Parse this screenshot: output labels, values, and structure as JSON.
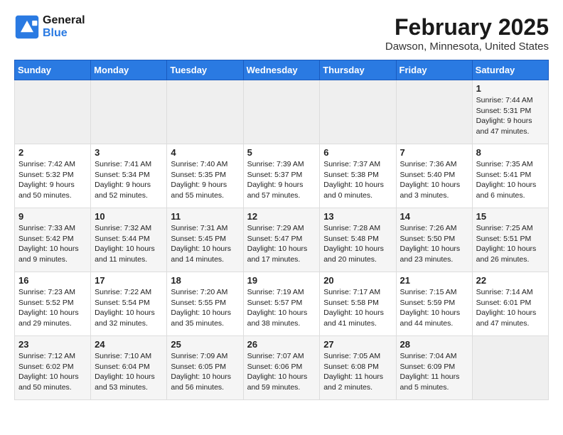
{
  "logo": {
    "line1": "General",
    "line2": "Blue"
  },
  "title": "February 2025",
  "location": "Dawson, Minnesota, United States",
  "days_of_week": [
    "Sunday",
    "Monday",
    "Tuesday",
    "Wednesday",
    "Thursday",
    "Friday",
    "Saturday"
  ],
  "weeks": [
    [
      {
        "day": "",
        "info": ""
      },
      {
        "day": "",
        "info": ""
      },
      {
        "day": "",
        "info": ""
      },
      {
        "day": "",
        "info": ""
      },
      {
        "day": "",
        "info": ""
      },
      {
        "day": "",
        "info": ""
      },
      {
        "day": "1",
        "info": "Sunrise: 7:44 AM\nSunset: 5:31 PM\nDaylight: 9 hours\nand 47 minutes."
      }
    ],
    [
      {
        "day": "2",
        "info": "Sunrise: 7:42 AM\nSunset: 5:32 PM\nDaylight: 9 hours\nand 50 minutes."
      },
      {
        "day": "3",
        "info": "Sunrise: 7:41 AM\nSunset: 5:34 PM\nDaylight: 9 hours\nand 52 minutes."
      },
      {
        "day": "4",
        "info": "Sunrise: 7:40 AM\nSunset: 5:35 PM\nDaylight: 9 hours\nand 55 minutes."
      },
      {
        "day": "5",
        "info": "Sunrise: 7:39 AM\nSunset: 5:37 PM\nDaylight: 9 hours\nand 57 minutes."
      },
      {
        "day": "6",
        "info": "Sunrise: 7:37 AM\nSunset: 5:38 PM\nDaylight: 10 hours\nand 0 minutes."
      },
      {
        "day": "7",
        "info": "Sunrise: 7:36 AM\nSunset: 5:40 PM\nDaylight: 10 hours\nand 3 minutes."
      },
      {
        "day": "8",
        "info": "Sunrise: 7:35 AM\nSunset: 5:41 PM\nDaylight: 10 hours\nand 6 minutes."
      }
    ],
    [
      {
        "day": "9",
        "info": "Sunrise: 7:33 AM\nSunset: 5:42 PM\nDaylight: 10 hours\nand 9 minutes."
      },
      {
        "day": "10",
        "info": "Sunrise: 7:32 AM\nSunset: 5:44 PM\nDaylight: 10 hours\nand 11 minutes."
      },
      {
        "day": "11",
        "info": "Sunrise: 7:31 AM\nSunset: 5:45 PM\nDaylight: 10 hours\nand 14 minutes."
      },
      {
        "day": "12",
        "info": "Sunrise: 7:29 AM\nSunset: 5:47 PM\nDaylight: 10 hours\nand 17 minutes."
      },
      {
        "day": "13",
        "info": "Sunrise: 7:28 AM\nSunset: 5:48 PM\nDaylight: 10 hours\nand 20 minutes."
      },
      {
        "day": "14",
        "info": "Sunrise: 7:26 AM\nSunset: 5:50 PM\nDaylight: 10 hours\nand 23 minutes."
      },
      {
        "day": "15",
        "info": "Sunrise: 7:25 AM\nSunset: 5:51 PM\nDaylight: 10 hours\nand 26 minutes."
      }
    ],
    [
      {
        "day": "16",
        "info": "Sunrise: 7:23 AM\nSunset: 5:52 PM\nDaylight: 10 hours\nand 29 minutes."
      },
      {
        "day": "17",
        "info": "Sunrise: 7:22 AM\nSunset: 5:54 PM\nDaylight: 10 hours\nand 32 minutes."
      },
      {
        "day": "18",
        "info": "Sunrise: 7:20 AM\nSunset: 5:55 PM\nDaylight: 10 hours\nand 35 minutes."
      },
      {
        "day": "19",
        "info": "Sunrise: 7:19 AM\nSunset: 5:57 PM\nDaylight: 10 hours\nand 38 minutes."
      },
      {
        "day": "20",
        "info": "Sunrise: 7:17 AM\nSunset: 5:58 PM\nDaylight: 10 hours\nand 41 minutes."
      },
      {
        "day": "21",
        "info": "Sunrise: 7:15 AM\nSunset: 5:59 PM\nDaylight: 10 hours\nand 44 minutes."
      },
      {
        "day": "22",
        "info": "Sunrise: 7:14 AM\nSunset: 6:01 PM\nDaylight: 10 hours\nand 47 minutes."
      }
    ],
    [
      {
        "day": "23",
        "info": "Sunrise: 7:12 AM\nSunset: 6:02 PM\nDaylight: 10 hours\nand 50 minutes."
      },
      {
        "day": "24",
        "info": "Sunrise: 7:10 AM\nSunset: 6:04 PM\nDaylight: 10 hours\nand 53 minutes."
      },
      {
        "day": "25",
        "info": "Sunrise: 7:09 AM\nSunset: 6:05 PM\nDaylight: 10 hours\nand 56 minutes."
      },
      {
        "day": "26",
        "info": "Sunrise: 7:07 AM\nSunset: 6:06 PM\nDaylight: 10 hours\nand 59 minutes."
      },
      {
        "day": "27",
        "info": "Sunrise: 7:05 AM\nSunset: 6:08 PM\nDaylight: 11 hours\nand 2 minutes."
      },
      {
        "day": "28",
        "info": "Sunrise: 7:04 AM\nSunset: 6:09 PM\nDaylight: 11 hours\nand 5 minutes."
      },
      {
        "day": "",
        "info": ""
      }
    ]
  ]
}
